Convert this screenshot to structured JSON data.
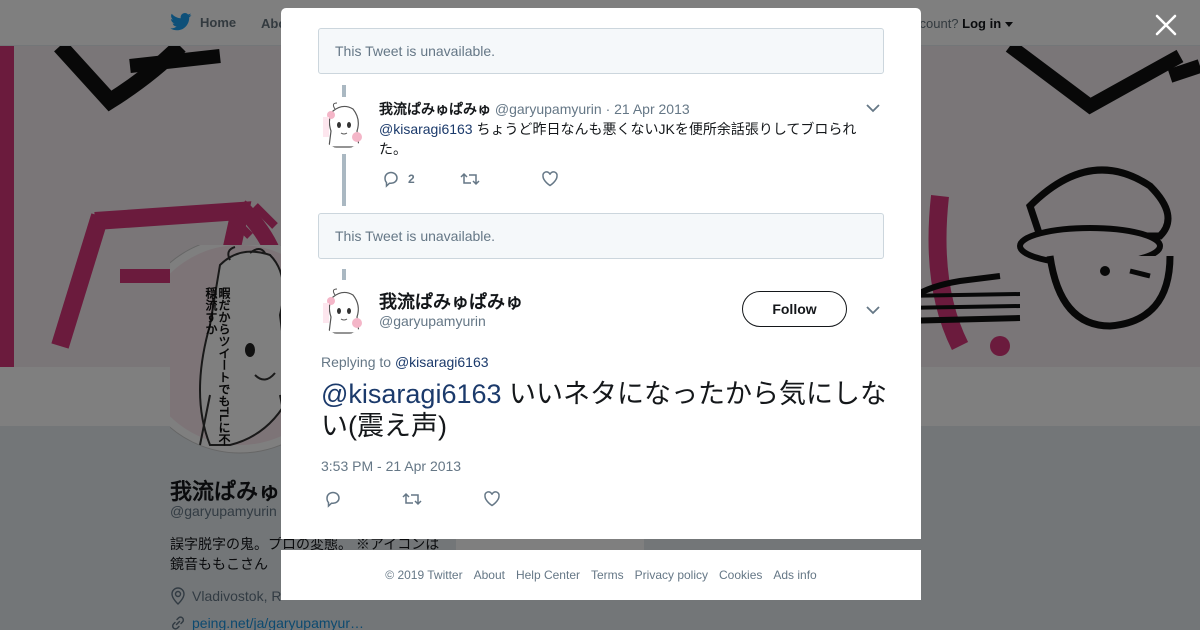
{
  "colors": {
    "accent": "#1da1f2",
    "text": "#14171a",
    "muted": "#657786",
    "link": "#1b3a6b",
    "banner_pink": "#d6377a"
  },
  "topnav": {
    "home_label": "Home",
    "about_label": "Abo",
    "account_text": "ccount?",
    "login_label": "Log in"
  },
  "profile": {
    "name": "我流ぱみゅぱ",
    "handle": "@garyupamyurin",
    "bio": "誤字脱字の鬼。プロの変態。 ※アイコンは鏡音ももこさん",
    "location": "Vladivostok, R",
    "website": "peing.net/ja/garyupamyur…",
    "avatar_caption": "暇だからツイートでもTLに不穏流すか",
    "mid_card_text": "Ads info"
  },
  "modal": {
    "unavailable_1": "This Tweet is unavailable.",
    "unavailable_2": "This Tweet is unavailable.",
    "reply": {
      "name": "我流ぱみゅぱみゅ",
      "handle": "@garyupamyurin",
      "date": "· 21 Apr 2013",
      "mention": "@kisaragi6163",
      "text": " ちょうど昨日なんも悪くないJKを便所余話張りしてブロられた。",
      "reply_count": "2",
      "retweet_count": "",
      "like_count": ""
    },
    "main": {
      "name": "我流ぱみゅぱみゅ",
      "handle": "@garyupamyurin",
      "follow_label": "Follow",
      "replying_prefix": "Replying to ",
      "replying_to": "@kisaragi6163",
      "mention": "@kisaragi6163",
      "text": " いいネタになったから気にしない(震え声)",
      "timestamp": "3:53 PM - 21 Apr 2013"
    }
  },
  "footer": {
    "copyright": "© 2019 Twitter",
    "links": [
      "About",
      "Help Center",
      "Terms",
      "Privacy policy",
      "Cookies",
      "Ads info"
    ]
  }
}
